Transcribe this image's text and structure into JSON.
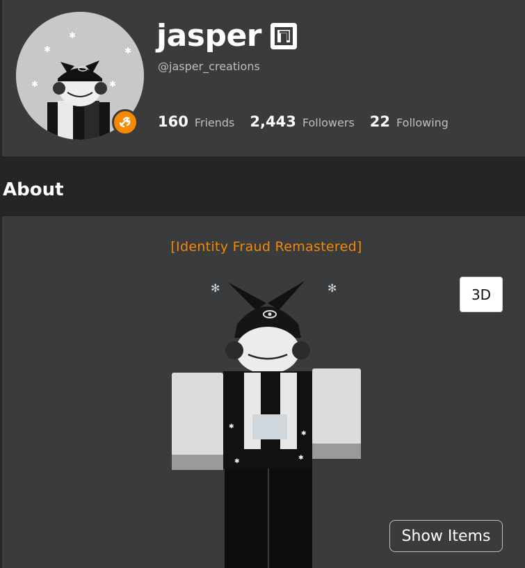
{
  "profile": {
    "display_name": "jasper",
    "username": "@jasper_creations",
    "verified_icon": "verified-badge-icon",
    "premium_icon": "premium-wrench-icon",
    "stats": [
      {
        "count": "160",
        "label": "Friends"
      },
      {
        "count": "2,443",
        "label": "Followers"
      },
      {
        "count": "22",
        "label": "Following"
      }
    ]
  },
  "about": {
    "title": "About"
  },
  "avatar_panel": {
    "outfit_name": "[Identity Fraud Remastered]",
    "toggle_3d_label": "3D",
    "show_items_label": "Show Items"
  },
  "colors": {
    "page_bg": "#232527",
    "card_bg": "#393b3d",
    "accent_orange": "#f68802",
    "muted_text": "#bdbebe"
  }
}
